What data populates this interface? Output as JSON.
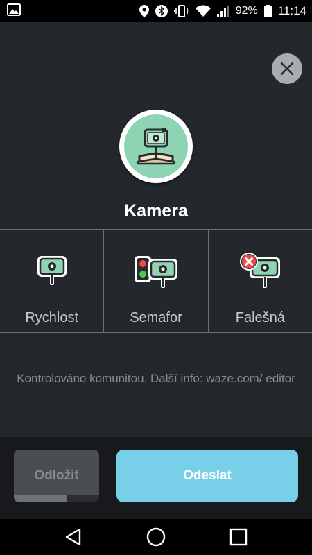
{
  "status_bar": {
    "battery": "92%",
    "time": "11:14",
    "icons": [
      "image-icon",
      "location-icon",
      "bluetooth-icon",
      "vibrate-icon",
      "wifi-icon",
      "signal-icon",
      "battery-icon"
    ]
  },
  "dialog": {
    "title": "Kamera",
    "close_icon": "close-icon",
    "options": [
      {
        "label": "Rychlost",
        "icon": "speed-camera-icon"
      },
      {
        "label": "Semafor",
        "icon": "red-light-camera-icon"
      },
      {
        "label": "Falešná",
        "icon": "fake-camera-icon"
      }
    ],
    "info": "Kontrolováno komunitou. Další info: waze.com/ editor"
  },
  "actions": {
    "later_label": "Odložit",
    "later_progress": 0.62,
    "send_label": "Odeslat"
  },
  "colors": {
    "background": "#24282d",
    "accent": "#77cfe8",
    "avatar_bg": "#8fd3b5"
  },
  "nav_bar": {
    "icons": [
      "back-icon",
      "home-icon",
      "recents-icon"
    ]
  }
}
